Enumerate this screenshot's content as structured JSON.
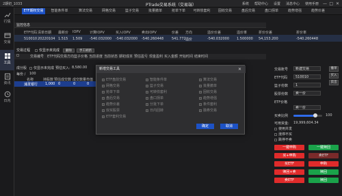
{
  "titlebar": {
    "account": "2期初_1033",
    "title": "PTrade交易系统（交易端）",
    "links": [
      "系统",
      "帮助中心",
      "设置",
      "消息中心",
      "使用手册"
    ],
    "min": "—",
    "max": "□",
    "close": "✕"
  },
  "nav": [
    {
      "label": "行情"
    },
    {
      "label": "交易"
    },
    {
      "label": "工具"
    },
    {
      "label": "资讯"
    },
    {
      "label": "日内"
    }
  ],
  "tabs": [
    "ETF期权交易",
    "智能条件单",
    "算法交易",
    "网格交易",
    "篮子交易",
    "批量撤单",
    "抢单下单",
    "可转债套利",
    "固收交易",
    "盘后交易",
    "盘口拐单",
    "趋势增强",
    "趋势价差"
  ],
  "monitor": {
    "title": "监控信息",
    "headers": [
      "ETF代码",
      "清单日期",
      "最新价",
      "IOPV",
      "计算IOPV",
      "买入IOPV",
      "卖出IOPV",
      "价差",
      "方向",
      "溢价价差",
      "溢价率",
      "折价价差",
      "折价率"
    ],
    "row": [
      "510010",
      "20220104",
      "1.515",
      "1.509",
      "-540.032000",
      "-540.032000",
      "-540.260448",
      "541.772",
      "溢价",
      "-540.032000",
      "1.500000",
      "54,153.200",
      "-540.260448"
    ]
  },
  "section2": {
    "title": "交易过程",
    "check_label": "仅显示未完成",
    "btn_clear": "删除",
    "btn_manual": "手工刷新",
    "headers": [
      "交易编号",
      "ETF代码",
      "交易方向",
      "篮子价格",
      "当前进度",
      "当前状态",
      "期初成本",
      "预估盈亏",
      "现金盈利",
      "买入金额",
      "开始时间",
      "结束时间"
    ]
  },
  "section3": {
    "title": "成分股",
    "check_label": "仅显示未完成",
    "buy_label": "预估买入:",
    "buy_value": "8,580.00",
    "per_label": "每份 /",
    "per_value": "100",
    "total_label": "成交",
    "status_label": "状态",
    "btn_refresh": "手工刷新",
    "headers": [
      "名称",
      "持股数",
      "预估成交数",
      "成交数量",
      "市值",
      "当前价格"
    ],
    "row": [
      "浦发银行",
      "1,000",
      "0",
      "0",
      "0",
      "0"
    ]
  },
  "form": {
    "account_label": "交易账号",
    "account_value": "新建交易",
    "etf_label": "ETF代码",
    "etf_value": "510010",
    "basket_label": "篮子份数",
    "basket_value": "1",
    "shares_label": "股票份数",
    "shares_value": "卖一价",
    "price_type_label": "ETF价格",
    "price_type_value": "卖一价",
    "level_label": "买卖比例",
    "level_value": "100",
    "level_fraction": 0.75,
    "avail_label": "可用资金:",
    "avail_value": "19,999,604.34",
    "opt1": "使用并发",
    "opt2": "涨停不买",
    "opt3": "跌停不卖",
    "buttons": {
      "basket_buy": "一键申购",
      "basket_sell": "一键赎回",
      "buy_sub": "买+申购",
      "sell_red": "卖ETF",
      "buy_etf": "买ETF",
      "sub": "申购",
      "red_sell": "赎回+卖",
      "redeem": "赎回",
      "sell_etf": "卖ETF",
      "redeem2": "赎回"
    }
  },
  "side_buttons": [
    "撤单",
    "买入",
    "卖出"
  ],
  "modal": {
    "title": "新增交易工具",
    "close": "✕",
    "options": [
      [
        "ETF盘前交易",
        "智能条件单",
        "算法交易"
      ],
      [
        "网格交易",
        "篮子交易",
        "批量撤单"
      ],
      [
        "抢单下单",
        "可转债套利",
        "固收交易"
      ],
      [
        "盘后交易",
        "盘口拐单",
        "趋势增强"
      ],
      [
        "趋势价差",
        "分批下单",
        "条件套利"
      ],
      [
        "双买股票",
        "日内回转",
        "融券交易"
      ],
      [
        "ETF套利交易"
      ]
    ],
    "ok": "确定",
    "cancel": "取消"
  }
}
